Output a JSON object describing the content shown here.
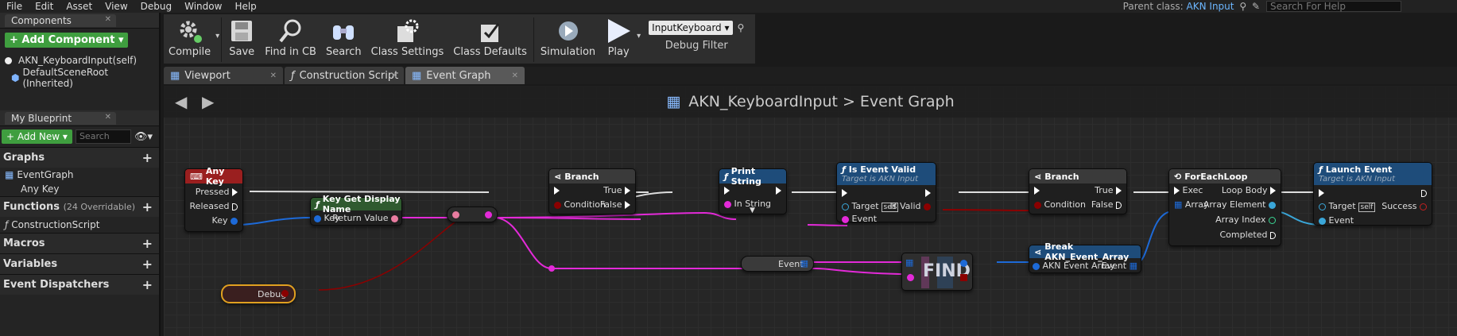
{
  "menu": [
    "File",
    "Edit",
    "Asset",
    "View",
    "Debug",
    "Window",
    "Help"
  ],
  "parent_class": {
    "label": "Parent class:",
    "value": "AKN Input"
  },
  "help_search": {
    "placeholder": "Search For Help"
  },
  "components": {
    "tab": "Components",
    "add_button": "Add Component",
    "items": [
      "AKN_KeyboardInput(self)",
      "DefaultSceneRoot (Inherited)"
    ]
  },
  "my_blueprint": {
    "tab": "My Blueprint",
    "add_new": "Add New",
    "search_placeholder": "Search",
    "sections": {
      "graphs": "Graphs",
      "event_graph": "EventGraph",
      "any_key": "Any Key",
      "functions": "Functions",
      "functions_count": "(24 Overridable)",
      "construction_script": "ConstructionScript",
      "macros": "Macros",
      "variables": "Variables",
      "event_dispatchers": "Event Dispatchers"
    }
  },
  "toolbar": {
    "compile": "Compile",
    "save": "Save",
    "find_in_cb": "Find in CB",
    "search": "Search",
    "class_settings": "Class Settings",
    "class_defaults": "Class Defaults",
    "simulation": "Simulation",
    "play": "Play",
    "debug_select": "InputKeyboard",
    "debug_filter": "Debug Filter"
  },
  "doc_tabs": [
    "Viewport",
    "Construction Script",
    "Event Graph"
  ],
  "graph": {
    "breadcrumb_root": "AKN_KeyboardInput",
    "breadcrumb_sep": ">",
    "breadcrumb_leaf": "Event Graph",
    "nodes": {
      "any_key": {
        "title": "Any Key",
        "pressed": "Pressed",
        "released": "Released",
        "key": "Key"
      },
      "key_display": {
        "title": "Key Get Display Name",
        "key": "Key",
        "ret": "Return Value"
      },
      "branch1": {
        "title": "Branch",
        "true": "True",
        "condition": "Condition",
        "false": "False"
      },
      "print": {
        "title": "Print String",
        "in_string": "In String"
      },
      "is_valid": {
        "title": "Is Event Valid",
        "sub": "Target is AKN Input",
        "target": "Target",
        "self": "self",
        "is_valid": "Is Valid",
        "event": "Event"
      },
      "branch2": {
        "title": "Branch",
        "true": "True",
        "condition": "Condition",
        "false": "False"
      },
      "foreach": {
        "title": "ForEachLoop",
        "exec": "Exec",
        "loop_body": "Loop Body",
        "array": "Array",
        "element": "Array Element",
        "index": "Array Index",
        "completed": "Completed"
      },
      "launch": {
        "title": "Launch Event",
        "sub": "Target is AKN Input",
        "target": "Target",
        "self": "self",
        "success": "Success",
        "event": "Event"
      },
      "event_var": {
        "title": "Event"
      },
      "find": {
        "title": "FIND"
      },
      "break": {
        "title": "Break AKN_Event_Array",
        "in": "AKN Event Array",
        "out": "Event"
      },
      "debug_var": {
        "title": "Debug"
      }
    }
  },
  "colors": {
    "exec": "#ffffff",
    "string": "#e32ad8",
    "bool": "#8b0000",
    "struct": "#1d6ad8",
    "object": "#3aa6d8",
    "green": "#3f9e3f"
  }
}
